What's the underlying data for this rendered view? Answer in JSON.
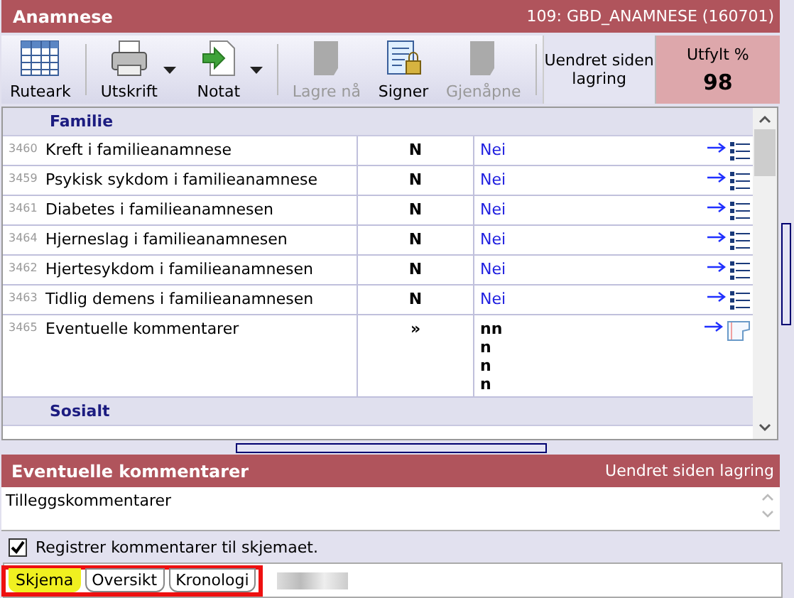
{
  "window": {
    "title": "Anamnese",
    "form_id": "109: GBD_ANAMNESE (160701)"
  },
  "toolbar": [
    {
      "label": "Ruteark",
      "kind": "grid",
      "disabled": false,
      "dropdown": false
    },
    {
      "label": "Utskrift",
      "kind": "printer",
      "disabled": false,
      "dropdown": true
    },
    {
      "label": "Notat",
      "kind": "note",
      "disabled": false,
      "dropdown": true
    },
    {
      "label": "Lagre nå",
      "kind": "blank",
      "disabled": true,
      "dropdown": false
    },
    {
      "label": "Signer",
      "kind": "sign",
      "disabled": false,
      "dropdown": false
    },
    {
      "label": "Gjenåpne",
      "kind": "blank",
      "disabled": true,
      "dropdown": false
    }
  ],
  "save_status": "Uendret siden lagring",
  "completion": {
    "label": "Utfylt %",
    "value": "98"
  },
  "sections": [
    {
      "title": "Familie",
      "rows": [
        {
          "id": "3460",
          "label": "Kreft i familieanamnese",
          "code": "N",
          "answer": [
            "Nei"
          ],
          "kind": "choice"
        },
        {
          "id": "3459",
          "label": "Psykisk sykdom i familieanamnese",
          "code": "N",
          "answer": [
            "Nei"
          ],
          "kind": "choice"
        },
        {
          "id": "3461",
          "label": "Diabetes i familieanamnesen",
          "code": "N",
          "answer": [
            "Nei"
          ],
          "kind": "choice"
        },
        {
          "id": "3464",
          "label": "Hjerneslag i familieanamnesen",
          "code": "N",
          "answer": [
            "Nei"
          ],
          "kind": "choice"
        },
        {
          "id": "3462",
          "label": "Hjertesykdom i familieanamnesen",
          "code": "N",
          "answer": [
            "Nei"
          ],
          "kind": "choice"
        },
        {
          "id": "3463",
          "label": "Tidlig demens i familieanamnesen",
          "code": "N",
          "answer": [
            "Nei"
          ],
          "kind": "choice"
        },
        {
          "id": "3465",
          "label": "Eventuelle kommentarer",
          "code": "»",
          "answer": [
            "nn",
            "n",
            "n",
            "n"
          ],
          "kind": "text"
        }
      ]
    },
    {
      "title": "Sosialt"
    }
  ],
  "comment_panel": {
    "title": "Eventuelle kommentarer",
    "status": "Uendret siden lagring",
    "value": "Tilleggskommentarer"
  },
  "register_comments": {
    "label": "Registrer kommentarer til skjemaet.",
    "checked": true
  },
  "tabs": [
    {
      "label": "Skjema",
      "selected": true
    },
    {
      "label": "Oversikt",
      "selected": false
    },
    {
      "label": "Kronologi",
      "selected": false
    }
  ]
}
